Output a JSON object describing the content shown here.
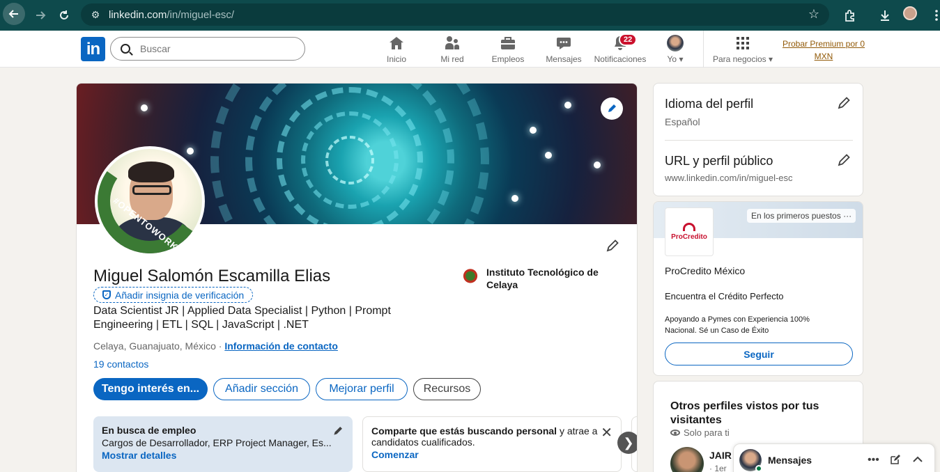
{
  "browser": {
    "url_host": "linkedin.com",
    "url_path": "/in/miguel-esc/"
  },
  "nav": {
    "logo_text": "in",
    "search_placeholder": "Buscar",
    "items": [
      {
        "label": "Inicio",
        "icon": "home-icon"
      },
      {
        "label": "Mi red",
        "icon": "network-icon"
      },
      {
        "label": "Empleos",
        "icon": "briefcase-icon"
      },
      {
        "label": "Mensajes",
        "icon": "chat-icon"
      },
      {
        "label": "Notificaciones",
        "icon": "bell-icon",
        "badge": "22"
      },
      {
        "label": "Yo",
        "icon": "avatar-icon"
      }
    ],
    "business_label": "Para negocios",
    "premium_line1": "Probar Premium por 0",
    "premium_line2": "MXN"
  },
  "profile": {
    "name": "Miguel Salomón Escamilla Elias",
    "verify_label": "Añadir insignia de verificación",
    "headline": "Data Scientist JR | Applied Data Specialist | Python | Prompt Engineering | ETL | SQL | JavaScript | .NET",
    "location": "Celaya, Guanajuato, México",
    "location_sep": " · ",
    "contact_info": "Información de contacto",
    "contacts": "19 contactos",
    "opentowork_text": "#OPENTOWORK",
    "education": "Instituto Tecnológico de Celaya",
    "buttons": {
      "interest": "Tengo interés en...",
      "add_section": "Añadir sección",
      "improve": "Mejorar perfil",
      "resources": "Recursos"
    },
    "open_to_work": {
      "title": "En busca de empleo",
      "roles": "Cargos de Desarrollador, ERP Project Manager, Es...",
      "link": "Mostrar detalles"
    },
    "share": {
      "bold": "Comparte que estás buscando personal",
      "rest": " y atrae a candidatos cualificados.",
      "link": "Comenzar"
    }
  },
  "sidebar": {
    "language": {
      "title": "Idioma del perfil",
      "value": "Español"
    },
    "public_url": {
      "title": "URL y perfil público",
      "value": "www.linkedin.com/in/miguel-esc"
    },
    "ad": {
      "tag": "En los primeros puestos",
      "logo_text": "ProCredito",
      "company": "ProCredito México",
      "tagline": "Encuentra el Crédito Perfecto",
      "description": "Apoyando a Pymes con Experiencia 100% Nacional. Sé un Caso de Éxito",
      "follow": "Seguir"
    },
    "others": {
      "title": "Otros perfiles vistos por tus visitantes",
      "subtitle": "Solo para ti",
      "first_name": "JAIR",
      "first_degree": "· 1er"
    }
  },
  "messaging": {
    "label": "Mensajes"
  }
}
